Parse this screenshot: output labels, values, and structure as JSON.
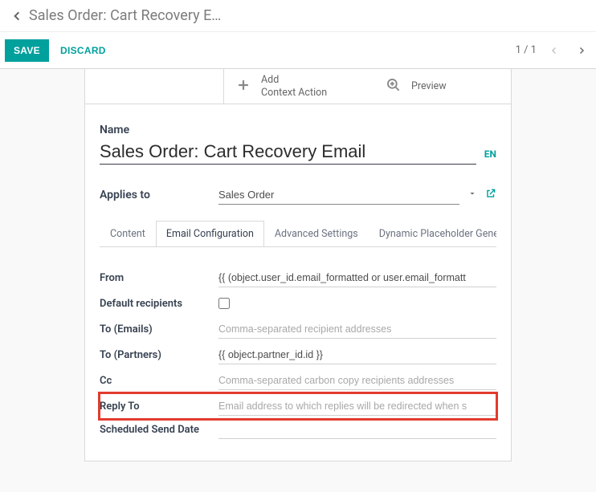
{
  "breadcrumb": {
    "title": "Sales Order: Cart Recovery E…"
  },
  "actions": {
    "save": "SAVE",
    "discard": "DISCARD"
  },
  "pager": {
    "text": "1 / 1"
  },
  "card_actions": {
    "add_line1": "Add",
    "add_line2": "Context Action",
    "preview": "Preview"
  },
  "form": {
    "name_label": "Name",
    "name_value": "Sales Order: Cart Recovery Email",
    "lang": "EN",
    "applies_label": "Applies to",
    "applies_value": "Sales Order"
  },
  "tabs": {
    "content": "Content",
    "email_config": "Email Configuration",
    "advanced": "Advanced Settings",
    "dynamic": "Dynamic Placeholder Generator"
  },
  "cfg": {
    "from_label": "From",
    "from_value": "{{ (object.user_id.email_formatted or user.email_formatt",
    "default_recipients_label": "Default recipients",
    "to_emails_label": "To (Emails)",
    "to_emails_placeholder": "Comma-separated recipient addresses",
    "to_partners_label": "To (Partners)",
    "to_partners_value": "{{ object.partner_id.id }}",
    "cc_label": "Cc",
    "cc_placeholder": "Comma-separated carbon copy recipients addresses",
    "reply_to_label": "Reply To",
    "reply_to_placeholder": "Email address to which replies will be redirected when s",
    "scheduled_label": "Scheduled Send Date"
  }
}
